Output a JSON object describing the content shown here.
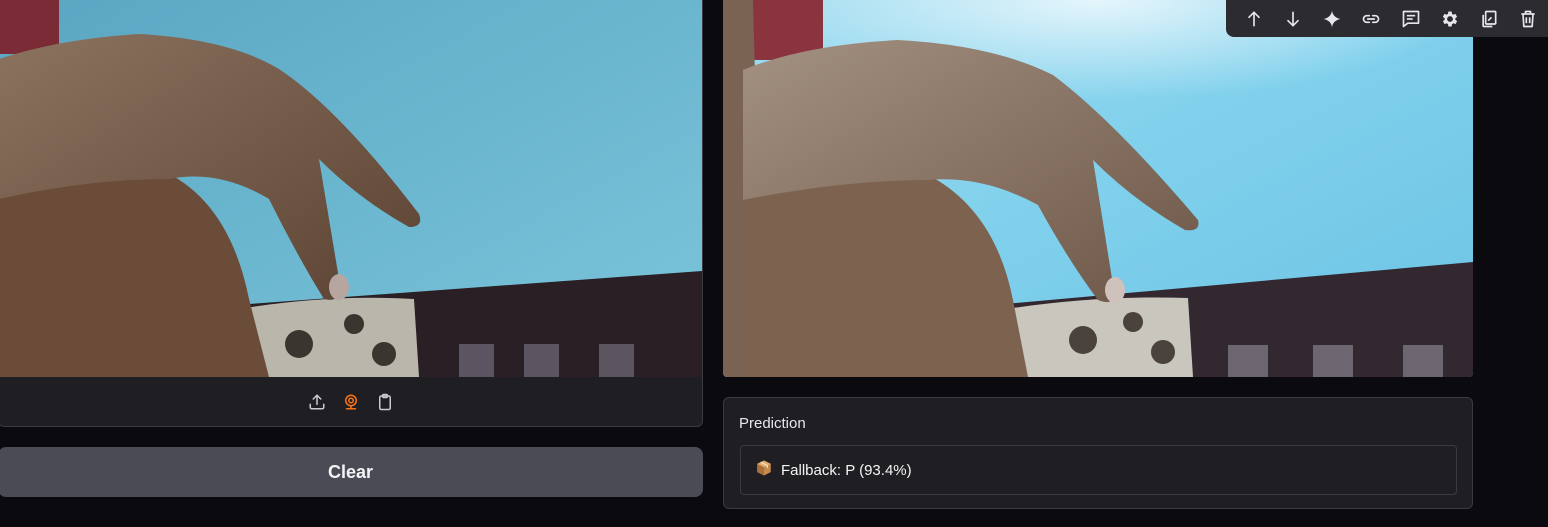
{
  "left_panel": {
    "image_alt": "Webcam capture of a hand gesture",
    "source_icons": [
      {
        "name": "upload-icon",
        "label": "Upload"
      },
      {
        "name": "webcam-icon",
        "label": "Webcam"
      },
      {
        "name": "clipboard-icon",
        "label": "Clipboard"
      }
    ],
    "accent_color": "#f97316"
  },
  "clear_button": {
    "label": "Clear"
  },
  "right_panel": {
    "image_alt": "Processed webcam capture of a hand gesture"
  },
  "toolbar": {
    "icons": [
      "arrow-up-icon",
      "arrow-down-icon",
      "sparkle-icon",
      "link-icon",
      "comment-icon",
      "gear-icon",
      "copy-icon",
      "trash-icon"
    ]
  },
  "prediction": {
    "title": "Prediction",
    "icon": "package-icon",
    "text": "Fallback: P (93.4%)"
  }
}
